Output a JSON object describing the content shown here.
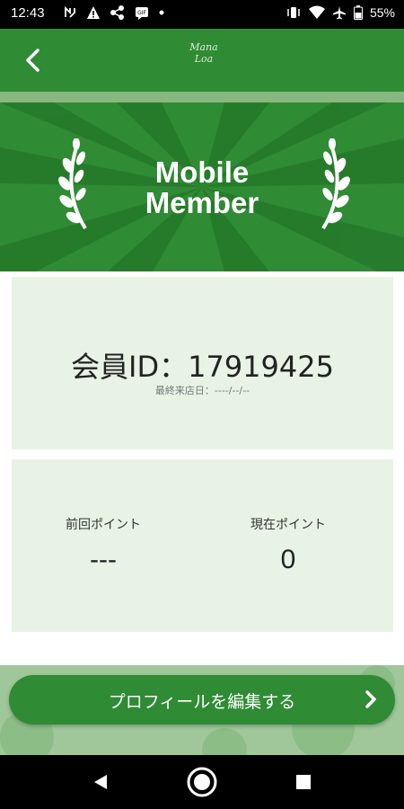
{
  "status_bar": {
    "time": "12:43",
    "battery": "55%",
    "left_icons": [
      "nfc-icon",
      "warning-icon",
      "network-share-icon",
      "message-icon",
      "dot-icon"
    ],
    "right_icons": [
      "vibrate-icon",
      "wifi-icon",
      "airplane-icon",
      "battery-icon"
    ]
  },
  "header": {
    "back_icon": "chevron-left-icon",
    "logo_line1": "Mana",
    "logo_line2": "Loa",
    "color": "#2f8b34"
  },
  "banner": {
    "title_line1": "Mobile",
    "title_line2": "Member",
    "left_decoration": "laurel-icon",
    "right_decoration": "laurel-icon"
  },
  "member_card": {
    "id_text": "会員ID：17919425",
    "last_visit": "最終来店日：----/--/--"
  },
  "points_card": {
    "previous_label": "前回ポイント",
    "previous_value": "---",
    "current_label": "現在ポイント",
    "current_value": "0"
  },
  "edit_profile_button": {
    "label": "プロフィールを編集する",
    "icon": "chevron-right-icon"
  },
  "nav_bar": {
    "icons": [
      "back-triangle-icon",
      "home-circle-icon",
      "recents-square-icon"
    ]
  },
  "colors": {
    "primary_green": "#2f8b34",
    "card_bg": "#e8f3e6"
  }
}
